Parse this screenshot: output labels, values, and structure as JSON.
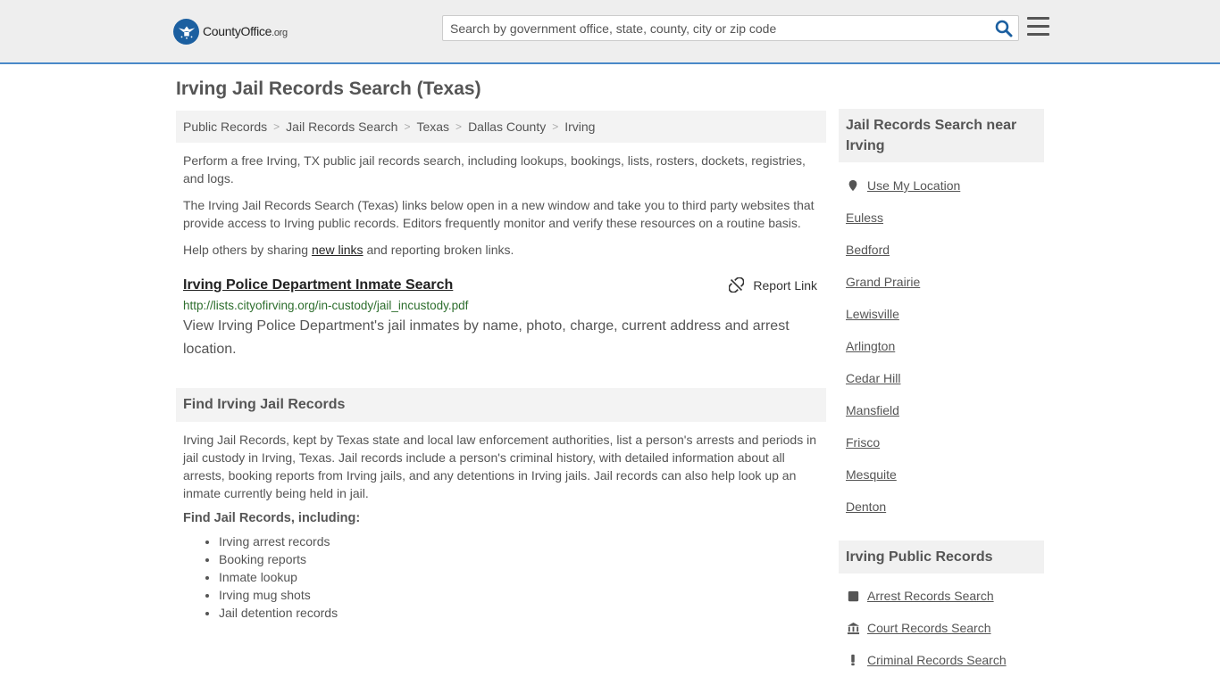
{
  "header": {
    "logo_main": "CountyOffice",
    "logo_suffix": ".org",
    "search_placeholder": "Search by government office, state, county, city or zip code"
  },
  "page": {
    "title": "Irving Jail Records Search (Texas)"
  },
  "breadcrumb": [
    "Public Records",
    "Jail Records Search",
    "Texas",
    "Dallas County",
    "Irving"
  ],
  "intro": {
    "p1": "Perform a free Irving, TX public jail records search, including lookups, bookings, lists, rosters, dockets, registries, and logs.",
    "p2": "The Irving Jail Records Search (Texas) links below open in a new window and take you to third party websites that provide access to Irving public records. Editors frequently monitor and verify these resources on a routine basis.",
    "p3_before": "Help others by sharing ",
    "p3_link": "new links",
    "p3_after": " and reporting broken links."
  },
  "result": {
    "title": "Irving Police Department Inmate Search",
    "report_label": "Report Link",
    "url": "http://lists.cityofirving.org/in-custody/jail_incustody.pdf",
    "description": "View Irving Police Department's jail inmates by name, photo, charge, current address and arrest location."
  },
  "find_section": {
    "heading": "Find Irving Jail Records",
    "body": "Irving Jail Records, kept by Texas state and local law enforcement authorities, list a person's arrests and periods in jail custody in Irving, Texas. Jail records include a person's criminal history, with detailed information about all arrests, booking reports from Irving jails, and any detentions in Irving jails. Jail records can also help look up an inmate currently being held in jail.",
    "subheading": "Find Jail Records, including:",
    "items": [
      "Irving arrest records",
      "Booking reports",
      "Inmate lookup",
      "Irving mug shots",
      "Jail detention records"
    ]
  },
  "sidebar": {
    "nearby_heading": "Jail Records Search near Irving",
    "use_location": "Use My Location",
    "nearby": [
      "Euless",
      "Bedford",
      "Grand Prairie",
      "Lewisville",
      "Arlington",
      "Cedar Hill",
      "Mansfield",
      "Frisco",
      "Mesquite",
      "Denton"
    ],
    "public_heading": "Irving Public Records",
    "public_links": [
      "Arrest Records Search",
      "Court Records Search",
      "Criminal Records Search"
    ]
  }
}
